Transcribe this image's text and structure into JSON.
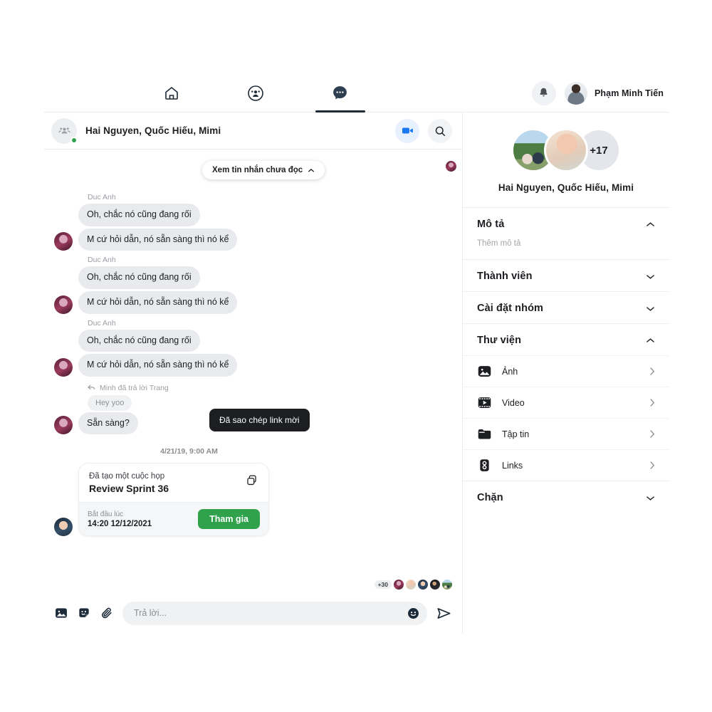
{
  "nav": {
    "tabs": [
      {
        "id": "home",
        "icon": "home-icon",
        "active": false
      },
      {
        "id": "groups",
        "icon": "groups-icon",
        "active": false
      },
      {
        "id": "messenger",
        "icon": "messenger-chat-icon",
        "active": true
      }
    ],
    "notifications_icon": "bell-icon",
    "account_name": "Phạm Minh Tiến"
  },
  "chat_header": {
    "title": "Hai Nguyen, Quốc Hiếu, Mimi",
    "online": true,
    "video_call_icon": "video-camera-icon",
    "search_icon": "search-icon"
  },
  "conversation": {
    "unread_pill": "Xem tin nhắn chưa đọc",
    "toast": "Đã sao chép link mời",
    "timestamp": "4/21/19, 9:00 AM",
    "groups": [
      {
        "sender": "Duc Anh",
        "messages": [
          "Oh, chắc nó cũng đang rối",
          "M cứ hỏi dẫn, nó sẵn sàng thì nó kể"
        ]
      },
      {
        "sender": "Duc Anh",
        "messages": [
          "Oh, chắc nó cũng đang rối",
          "M cứ hỏi dẫn, nó sẵn sàng thì nó kể"
        ]
      },
      {
        "sender": "Duc Anh",
        "messages": [
          "Oh, chắc nó cũng đang rối",
          "M cứ hỏi dẫn, nó sẵn sàng thì nó kể"
        ]
      }
    ],
    "reply": {
      "meta": "Minh đã trả lời Trang",
      "quoted": "Hey yoo",
      "message": "Sẵn sàng?"
    },
    "meeting_card": {
      "subtitle": "Đã tạo một cuộc họp",
      "title": "Review Sprint 36",
      "copy_icon": "copy-icon",
      "start_label": "Bắt đầu lúc",
      "start_value": "14:20 12/12/2021",
      "join_label": "Tham gia",
      "join_color": "#31a24c"
    },
    "seen_by": {
      "overflow": "+30",
      "avatars": [
        "avatar-1",
        "avatar-2",
        "avatar-3",
        "avatar-4",
        "avatar-5"
      ]
    }
  },
  "composer": {
    "image_icon": "image-icon",
    "sticker_icon": "sticker-icon",
    "attach_icon": "paperclip-icon",
    "placeholder": "Trả lời...",
    "value": "",
    "emoji_icon": "emoji-smiley-icon",
    "send_icon": "send-icon"
  },
  "panel": {
    "avatar_overflow": "+17",
    "group_name": "Hai Nguyen, Quốc Hiếu, Mimi",
    "sections": [
      {
        "id": "description",
        "title": "Mô tả",
        "expanded": true,
        "placeholder": "Thêm mô tả"
      },
      {
        "id": "members",
        "title": "Thành viên",
        "expanded": false
      },
      {
        "id": "group-settings",
        "title": "Cài đặt nhóm",
        "expanded": false
      },
      {
        "id": "library",
        "title": "Thư viện",
        "expanded": true
      },
      {
        "id": "block",
        "title": "Chặn",
        "expanded": false
      }
    ],
    "library_items": [
      {
        "id": "photos",
        "label": "Ảnh",
        "icon": "photo-icon"
      },
      {
        "id": "video",
        "label": "Video",
        "icon": "video-film-icon"
      },
      {
        "id": "files",
        "label": "Tập tin",
        "icon": "folder-icon"
      },
      {
        "id": "links",
        "label": "Links",
        "icon": "link-chain-icon"
      }
    ]
  },
  "colors": {
    "accent_blue": "#1877f2",
    "green": "#31a24c",
    "dark": "#1c1e21",
    "bubble": "#e9eaed"
  }
}
